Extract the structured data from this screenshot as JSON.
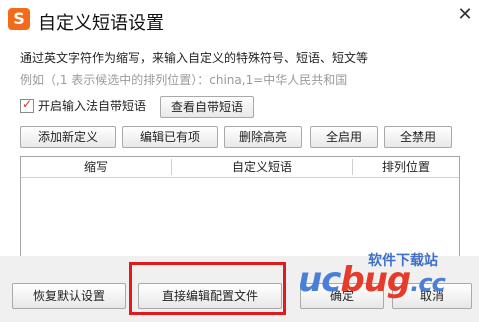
{
  "window": {
    "title": "自定义短语设置",
    "logo_glyph": "S",
    "close_glyph": "✕"
  },
  "info": {
    "description": "通过英文字符作为缩写，来输入自定义的特殊符号、短语、短文等",
    "example": "例如（,1 表示候选中的排列位置）：china,1=中华人民共和国"
  },
  "options": {
    "enable_label": "开启输入法自带短语",
    "enable_checked": true,
    "view_builtin_label": "查看自带短语"
  },
  "toolbar": {
    "add_label": "添加新定义",
    "edit_label": "编辑已有项",
    "delete_label": "删除高亮",
    "enable_all_label": "全启用",
    "disable_all_label": "全禁用"
  },
  "table": {
    "columns": [
      "缩写",
      "自定义短语",
      "排列位置"
    ],
    "rows": []
  },
  "footer": {
    "restore_label": "恢复默认设置",
    "edit_config_label": "直接编辑配置文件",
    "ok_label": "确定",
    "cancel_label": "取消"
  },
  "watermark": {
    "logo_text_1": "uc",
    "logo_text_2": "bug",
    "logo_text_3": ".cc",
    "site_name": "软件下载站"
  },
  "colors": {
    "highlight_border": "#e01b1b",
    "logo_bg": "#f36a1a"
  }
}
